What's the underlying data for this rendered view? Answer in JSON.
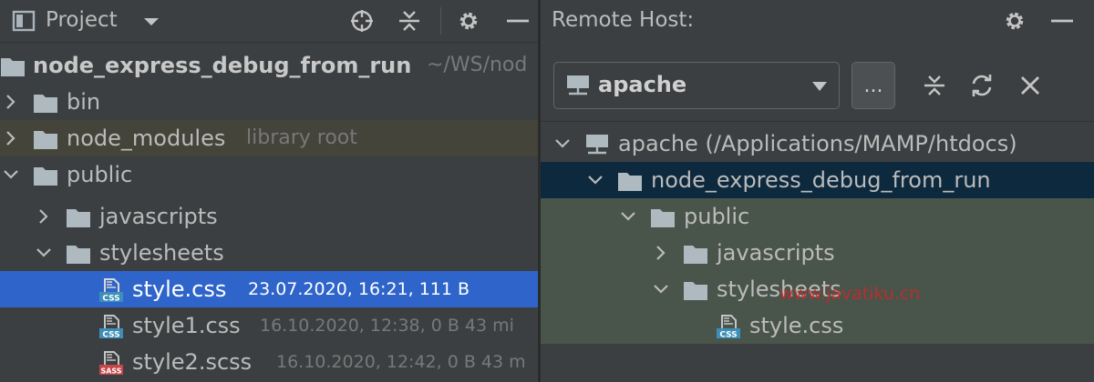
{
  "project_panel": {
    "title": "Project",
    "icons": [
      "project-window-icon",
      "dropdown-caret-icon",
      "locate-icon",
      "collapse-all-icon",
      "gear-icon",
      "hide-icon"
    ],
    "tree": {
      "root": {
        "label": "node_express_debug_from_run",
        "hint": "~/WS/nod"
      },
      "bin": {
        "label": "bin"
      },
      "node_modules": {
        "label": "node_modules",
        "hint": "library root"
      },
      "public": {
        "label": "public"
      },
      "javascripts": {
        "label": "javascripts"
      },
      "stylesheets": {
        "label": "stylesheets"
      },
      "style_css": {
        "label": "style.css",
        "hint": "23.07.2020, 16:21, 111 B",
        "icon_text": "CSS"
      },
      "style1_css": {
        "label": "style1.css",
        "hint": "16.10.2020, 12:38, 0 B 43 mi",
        "icon_text": "CSS"
      },
      "style2_scss": {
        "label": "style2.scss",
        "hint": "16.10.2020, 12:42, 0 B 43 m",
        "icon_text": "SASS"
      }
    }
  },
  "remote_panel": {
    "title": "Remote Host:",
    "server_select": {
      "value": "apache"
    },
    "browse_button": "...",
    "tree": {
      "apache": {
        "label": "apache (/Applications/MAMP/htdocs)"
      },
      "project": {
        "label": "node_express_debug_from_run"
      },
      "public": {
        "label": "public"
      },
      "javascripts": {
        "label": "javascripts"
      },
      "stylesheets": {
        "label": "stylesheets"
      },
      "style_css": {
        "label": "style.css",
        "icon_text": "CSS"
      }
    }
  },
  "watermark": "www.javatiku.cn",
  "colors": {
    "selection": "#2f65ca",
    "library_root": "#45443a",
    "remote_selected": "#0d293e",
    "remote_highlight": "#49544a",
    "folder": "#aeb9c0",
    "css_badge": "#3d8fb8",
    "sass_badge": "#c7464a"
  }
}
